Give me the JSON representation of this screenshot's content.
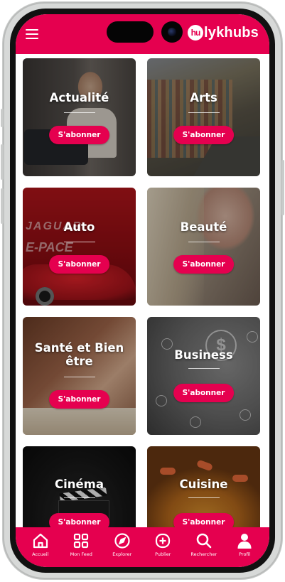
{
  "brand": {
    "logo_badge": "hu",
    "logo_text": "lykhubs"
  },
  "colors": {
    "accent": "#e5004f"
  },
  "categories": [
    {
      "title": "Actualité",
      "button": "S'abonner",
      "image": "man-typewriter"
    },
    {
      "title": "Arts",
      "button": "S'abonner",
      "image": "street-art-wall"
    },
    {
      "title": "Auto",
      "button": "S'abonner",
      "image": "red-jaguar-epace"
    },
    {
      "title": "Beauté",
      "button": "S'abonner",
      "image": "woman-face"
    },
    {
      "title": "Santé et Bien être",
      "button": "S'abonner",
      "image": "massage"
    },
    {
      "title": "Business",
      "button": "S'abonner",
      "image": "network-dollar"
    },
    {
      "title": "Cinéma",
      "button": "S'abonner",
      "image": "clapperboard"
    },
    {
      "title": "Cuisine",
      "button": "S'abonner",
      "image": "paella"
    }
  ],
  "auto_brand": {
    "line1": "JAGUAR",
    "line2": "E-PACE"
  },
  "nav": [
    {
      "label": "Accueil",
      "icon": "home-icon"
    },
    {
      "label": "Mon Feed",
      "icon": "grid-icon"
    },
    {
      "label": "Explorer",
      "icon": "compass-icon"
    },
    {
      "label": "Publier",
      "icon": "add-post-icon"
    },
    {
      "label": "Rechercher",
      "icon": "search-icon"
    },
    {
      "label": "Profil",
      "icon": "profile-icon"
    }
  ]
}
